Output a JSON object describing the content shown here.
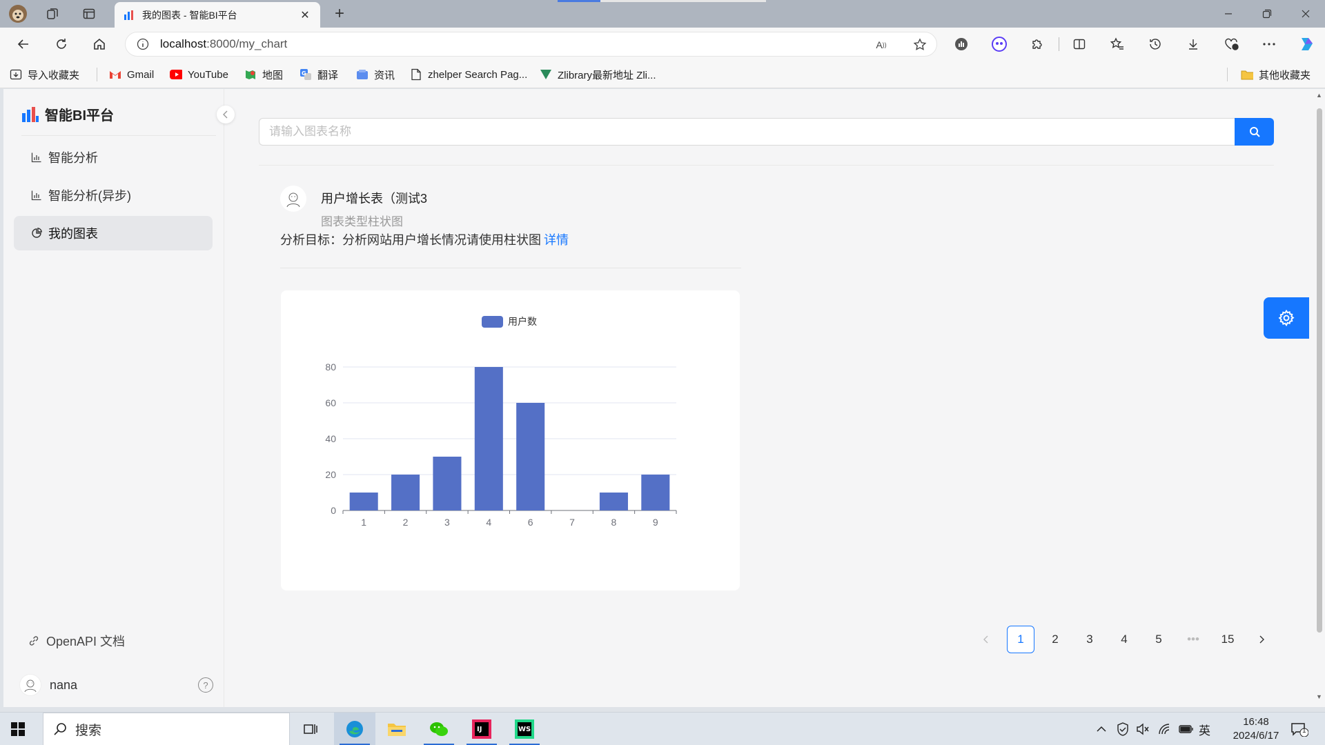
{
  "browser": {
    "tab_title": "我的图表 - 智能BI平台",
    "address": {
      "host": "localhost",
      "path": ":8000/my_chart"
    },
    "bookmarks": [
      {
        "label": "导入收藏夹",
        "icon": "import-icon"
      },
      {
        "label": "Gmail",
        "icon": "gmail-icon"
      },
      {
        "label": "YouTube",
        "icon": "youtube-icon"
      },
      {
        "label": "地图",
        "icon": "maps-icon"
      },
      {
        "label": "翻译",
        "icon": "translate-icon"
      },
      {
        "label": "资讯",
        "icon": "news-icon"
      },
      {
        "label": "zhelper Search Pag...",
        "icon": "page-icon"
      },
      {
        "label": "Zlibrary最新地址 Zli...",
        "icon": "zlibrary-icon"
      }
    ],
    "other_bookmarks": "其他收藏夹"
  },
  "sidebar": {
    "logo_text": "智能BI平台",
    "items": [
      {
        "label": "智能分析",
        "icon": "bar-chart-icon"
      },
      {
        "label": "智能分析(异步)",
        "icon": "bar-chart-icon"
      },
      {
        "label": "我的图表",
        "icon": "pie-chart-icon"
      }
    ],
    "active_index": 2,
    "openapi_label": "OpenAPI 文档",
    "username": "nana"
  },
  "main": {
    "search_placeholder": "请输入图表名称",
    "card": {
      "title": "用户增长表（测试3",
      "subtitle": "图表类型柱状图",
      "goal_label": "分析目标：分析网站用户增长情况请使用柱状图",
      "detail_link": "详情"
    }
  },
  "chart_data": {
    "type": "bar",
    "categories": [
      "1",
      "2",
      "3",
      "4",
      "6",
      "7",
      "8",
      "9"
    ],
    "series": [
      {
        "name": "用户数",
        "values": [
          10,
          20,
          30,
          80,
          60,
          0,
          10,
          20
        ]
      }
    ],
    "ylim": [
      0,
      80
    ],
    "yticks": [
      0,
      20,
      40,
      60,
      80
    ],
    "legend_position": "top-center",
    "color": "#5470c6",
    "grid": true
  },
  "pagination": {
    "pages": [
      "1",
      "2",
      "3",
      "4",
      "5"
    ],
    "ellipsis": "•••",
    "last": "15",
    "current": "1"
  },
  "taskbar": {
    "search_label": "搜索",
    "ime": "英",
    "time": "16:48",
    "date": "2024/6/17",
    "notification_count": "1"
  },
  "colors": {
    "primary": "#1677ff",
    "bar": "#5470c6"
  }
}
